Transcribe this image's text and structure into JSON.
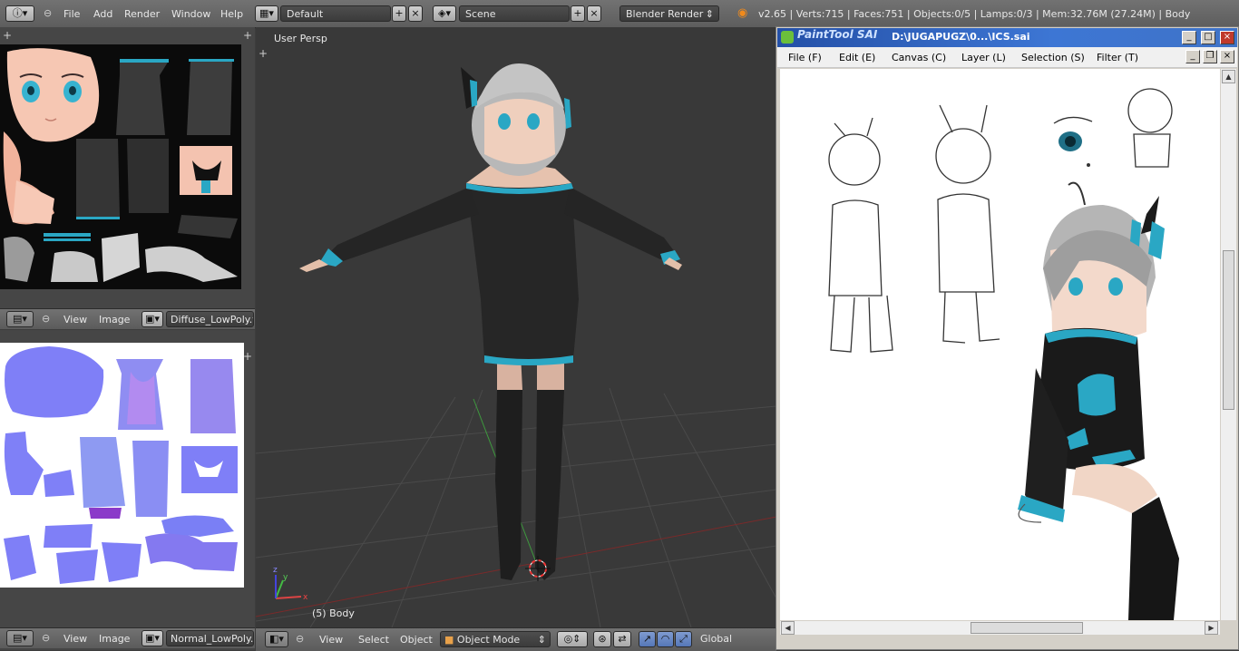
{
  "blender": {
    "top_menu": [
      "File",
      "Add",
      "Render",
      "Window",
      "Help"
    ],
    "layout": "Default",
    "scene": "Scene",
    "render_engine": "Blender Render",
    "stats": "v2.65 | Verts:715 | Faces:751 | Objects:0/5 | Lamps:0/3 | Mem:32.76M (27.24M) | Body"
  },
  "image_editor_top": {
    "menu": [
      "View",
      "Image"
    ],
    "image_name": "Diffuse_LowPoly.tga"
  },
  "image_editor_bottom": {
    "menu": [
      "View",
      "Image"
    ],
    "image_name": "Normal_LowPoly.tga"
  },
  "viewport": {
    "view_name": "User Persp",
    "object_label": "(5) Body",
    "menu": [
      "View",
      "Select",
      "Object"
    ],
    "mode": "Object Mode",
    "orientation": "Global",
    "axis_labels": [
      "x",
      "y",
      "z"
    ]
  },
  "sai": {
    "app_logo": "PaintTool SAI",
    "document_path": "D:\\JUGAPUGZ\\0...\\ICS.sai",
    "menu": [
      "File (F)",
      "Edit (E)",
      "Canvas (C)",
      "Layer (L)",
      "Selection (S)",
      "Filter (T)"
    ],
    "window_buttons": [
      "_",
      "□",
      "×"
    ]
  },
  "colors": {
    "blender_bg": "#464646",
    "viewport_bg": "#393939",
    "sai_titlebar": "#2c5fbf",
    "accent_teal": "#2aa7c4",
    "skin": "#f5c6b0",
    "normal_map": "#7f7ff7"
  }
}
